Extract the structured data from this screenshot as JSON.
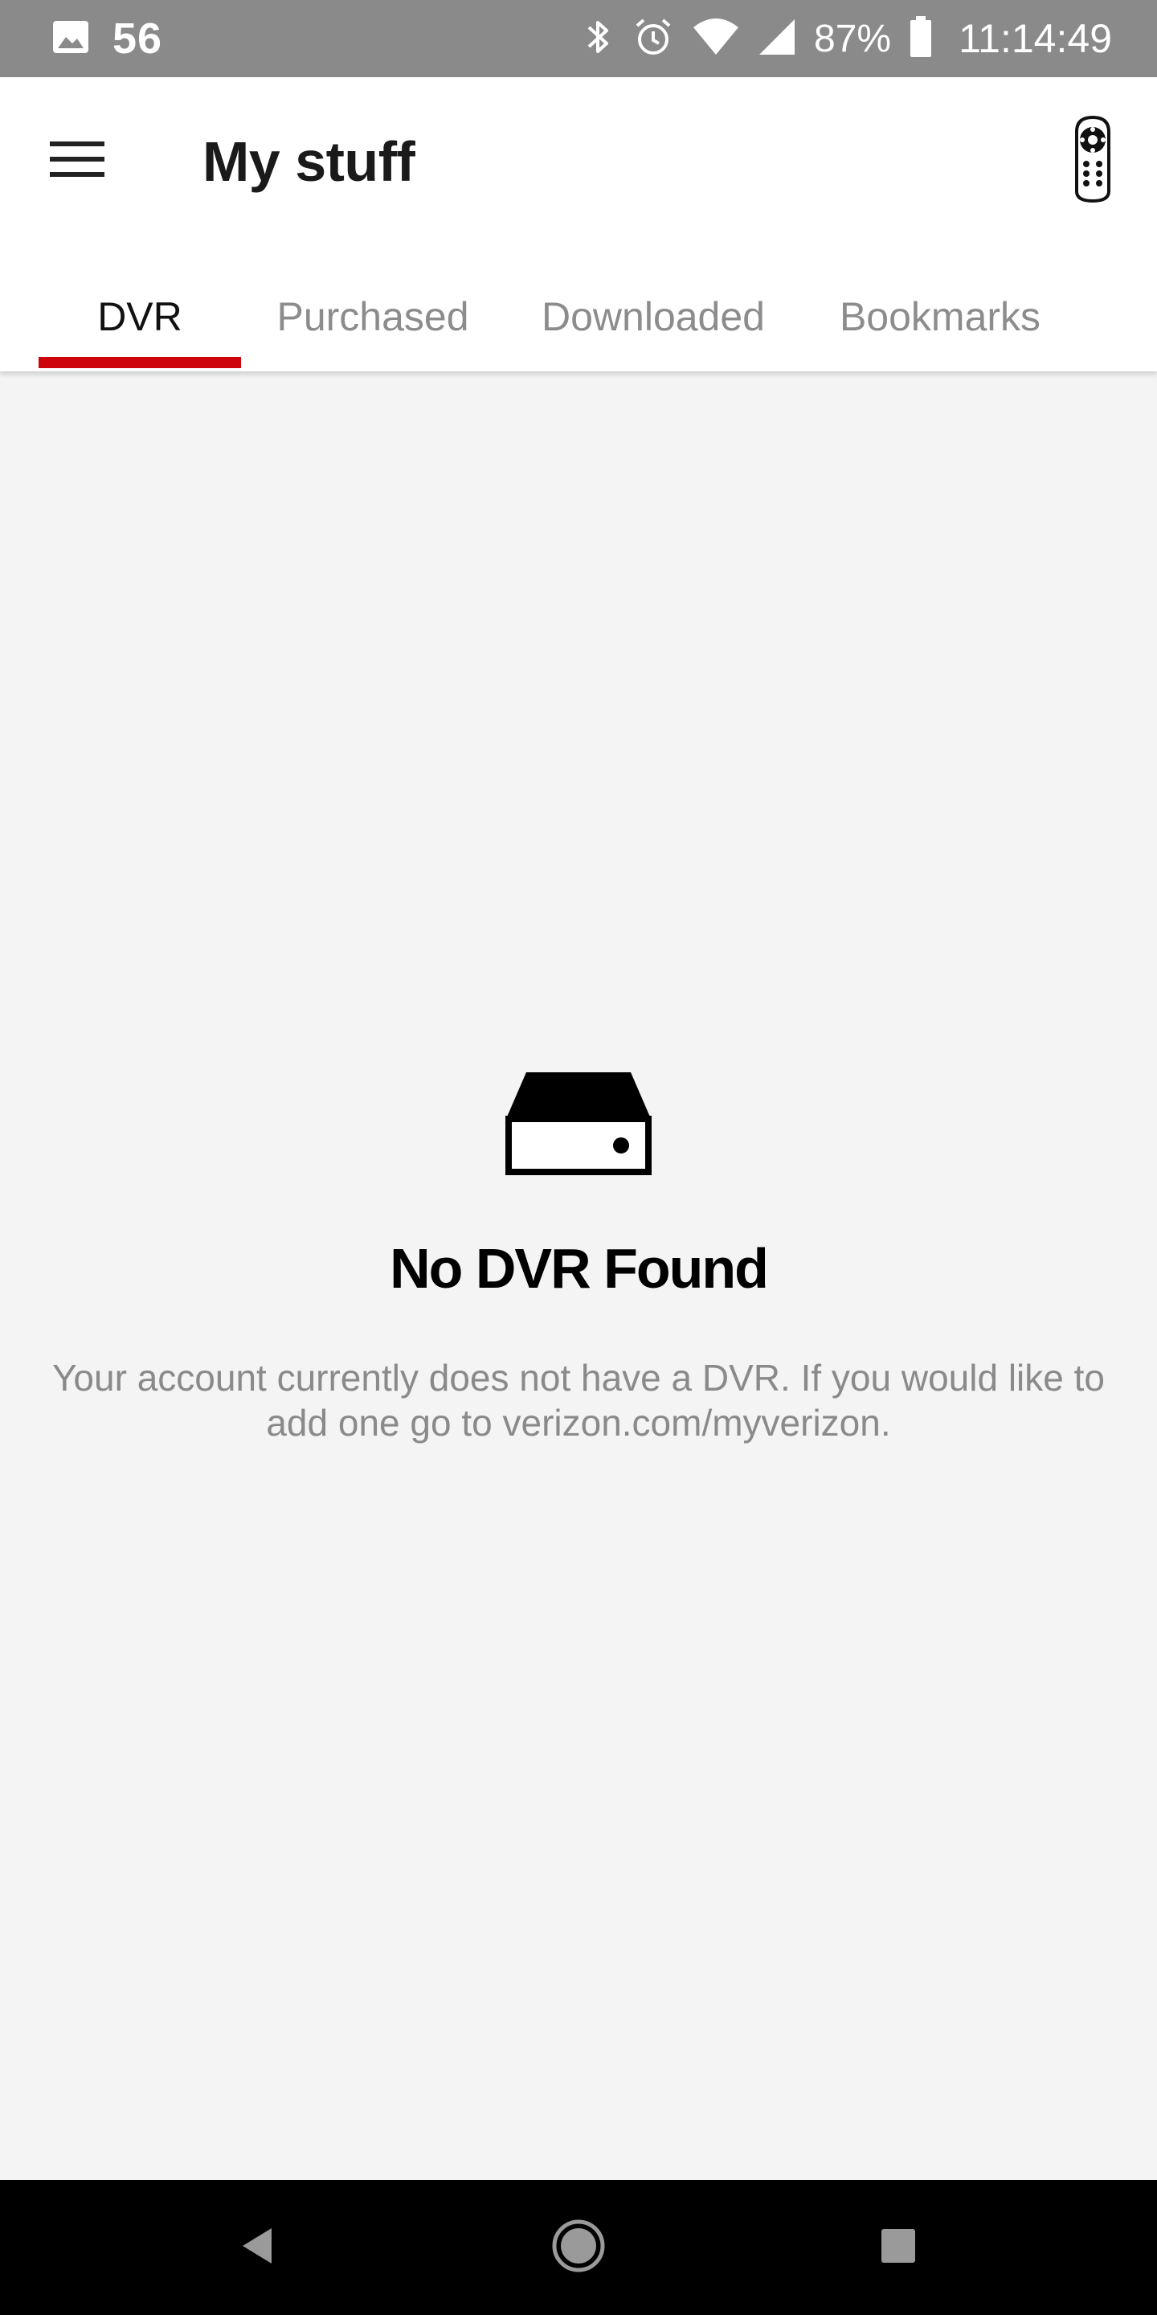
{
  "status_bar": {
    "notification_count": "56",
    "battery_percent": "87%",
    "time": "11:14:49",
    "icons": [
      "image-icon",
      "bluetooth-icon",
      "alarm-icon",
      "wifi-icon",
      "cell-signal-icon",
      "battery-icon"
    ]
  },
  "header": {
    "title": "My stuff",
    "menu_icon": "hamburger-menu-icon",
    "remote_icon": "remote-control-icon"
  },
  "tabs": [
    {
      "label": "DVR",
      "active": true
    },
    {
      "label": "Purchased",
      "active": false
    },
    {
      "label": "Downloaded",
      "active": false
    },
    {
      "label": "Bookmarks",
      "active": false
    }
  ],
  "empty_state": {
    "icon": "dvr-box-icon",
    "title": "No DVR Found",
    "message": "Your account currently does not have a DVR. If you would like to add one go to verizon.com/myverizon."
  },
  "nav_bar": {
    "icons": [
      "back-icon",
      "home-icon",
      "recents-icon"
    ]
  },
  "colors": {
    "accent": "#cd040b",
    "status_bar": "#8a8a8a",
    "background": "#f4f4f4",
    "nav_bar": "#000000"
  }
}
